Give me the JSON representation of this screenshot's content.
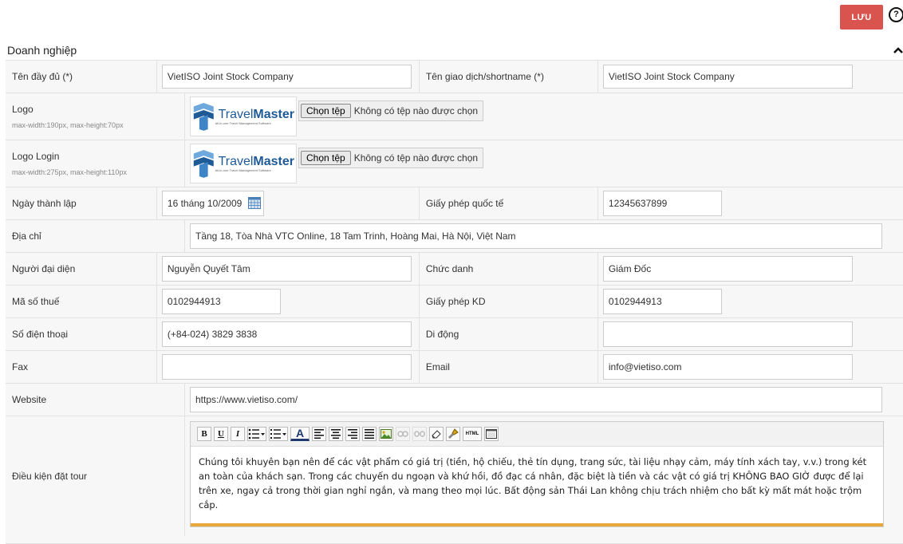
{
  "toolbar": {
    "save_label": "LƯU",
    "help_label": "?"
  },
  "section": {
    "title": "Doanh nghiệp"
  },
  "fields": {
    "full_name": {
      "label": "Tên đầy đủ (*)",
      "value": "VietISO Joint Stock Company"
    },
    "shortname": {
      "label": "Tên giao dịch/shortname (*)",
      "value": "VietISO Joint Stock Company"
    },
    "logo": {
      "label": "Logo",
      "hint": "max-width:190px, max-height:70px",
      "choose": "Chọn tệp",
      "status": "Không có tệp nào được chọn"
    },
    "logo_login": {
      "label": "Logo Login",
      "hint": "max-width:275px, max-height:110px",
      "choose": "Chọn tệp",
      "status": "Không có tệp nào được chọn"
    },
    "logo_brand": {
      "name_a": "Travel",
      "name_b": "Master",
      "tagline": "All-in-one Travel Management Software"
    },
    "founded": {
      "label": "Ngày thành lập",
      "value": "16 tháng 10/2009"
    },
    "intl_license": {
      "label": "Giấy phép quốc tế",
      "value": "12345637899"
    },
    "address": {
      "label": "Địa chỉ",
      "value": "Tầng 18, Tòa Nhà VTC Online, 18 Tam Trinh, Hoàng Mai, Hà Nội, Việt Nam"
    },
    "representative": {
      "label": "Người đại diện",
      "value": "Nguyễn Quyết Tâm"
    },
    "position": {
      "label": "Chức danh",
      "value": "Giám Đốc"
    },
    "tax_code": {
      "label": "Mã số thuế",
      "value": "0102944913"
    },
    "business_license": {
      "label": "Giấy phép KD",
      "value": "0102944913"
    },
    "phone": {
      "label": "Số điện thoại",
      "value": "(+84-024) 3829 3838"
    },
    "mobile": {
      "label": "Di động",
      "value": ""
    },
    "fax": {
      "label": "Fax",
      "value": ""
    },
    "email": {
      "label": "Email",
      "value": "info@vietiso.com"
    },
    "website": {
      "label": "Website",
      "value": "https://www.vietiso.com/"
    },
    "tour_terms": {
      "label": "Điều kiện đặt tour",
      "value": "Chúng tôi khuyên bạn nên để các vật phẩm có giá trị (tiền, hộ chiếu, thẻ tín dụng, trang sức, tài liệu nhạy cảm, máy tính xách tay, v.v.) trong két an toàn của khách sạn. Trong các chuyến du ngoạn và khứ hồi, đồ đạc cá nhân, đặc biệt là tiền và các vật có giá trị KHÔNG BAO GIỜ được để lại trên xe, ngay cả trong thời gian nghỉ ngắn, và mang theo mọi lúc. Bất động sản Thái Lan không chịu trách nhiệm cho bất kỳ mất mát hoặc trộm cắp."
    }
  },
  "editor_toolbar": {
    "bold": "B",
    "underline": "U",
    "italic": "I",
    "font_color": "A",
    "html": "HTML"
  },
  "colors": {
    "save": "#d9534f",
    "editor_border": "#e6a93a"
  }
}
